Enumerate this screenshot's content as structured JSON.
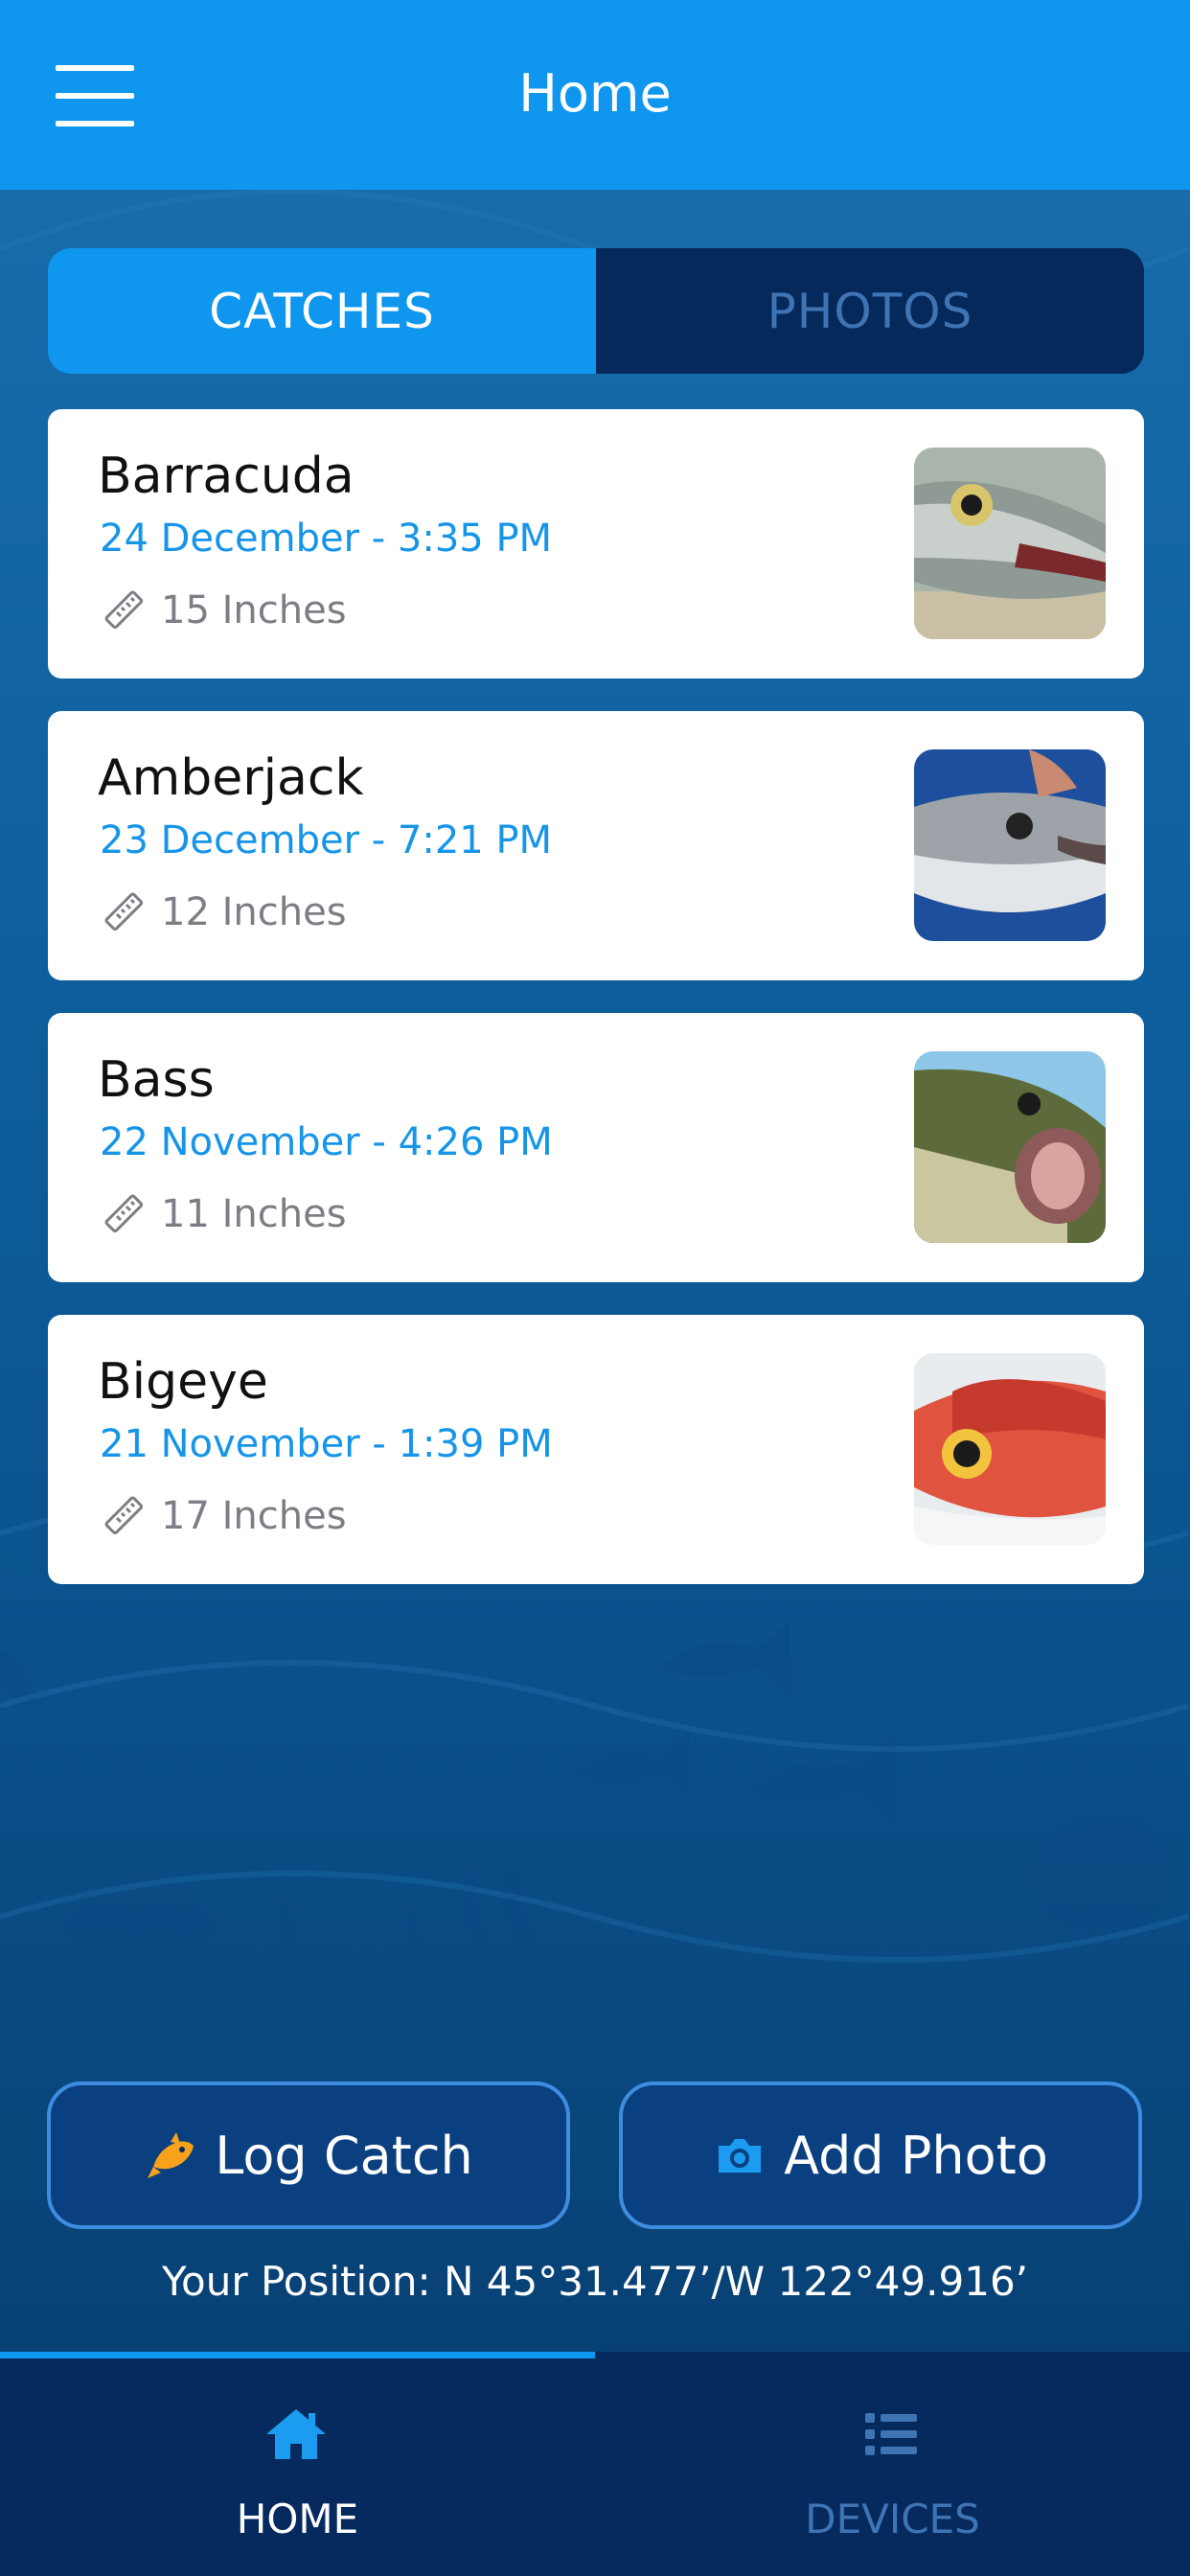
{
  "header": {
    "title": "Home",
    "menu_icon": "hamburger-menu-icon"
  },
  "tabs": [
    {
      "label": "CATCHES",
      "active": true
    },
    {
      "label": "PHOTOS",
      "active": false
    }
  ],
  "catches": [
    {
      "name": "Barracuda",
      "date": "24 December - 3:35 PM",
      "length": "15 Inches",
      "photo": "barracuda-photo"
    },
    {
      "name": "Amberjack",
      "date": "23 December - 7:21 PM",
      "length": "12 Inches",
      "photo": "amberjack-photo"
    },
    {
      "name": "Bass",
      "date": "22 November - 4:26 PM",
      "length": "11 Inches",
      "photo": "bass-photo"
    },
    {
      "name": "Bigeye",
      "date": "21 November - 1:39 PM",
      "length": "17 Inches",
      "photo": "bigeye-photo"
    }
  ],
  "actions": {
    "log_catch": {
      "label": "Log Catch",
      "icon": "fish-icon",
      "icon_color": "#f6a21c"
    },
    "add_photo": {
      "label": "Add Photo",
      "icon": "camera-icon",
      "icon_color": "#1b9cf0"
    }
  },
  "position": {
    "text": "Your Position: N 45°31.477’/W 122°49.916’"
  },
  "bottom_nav": [
    {
      "label": "HOME",
      "icon": "home-icon",
      "active": true
    },
    {
      "label": "DEVICES",
      "icon": "list-icon",
      "active": false
    }
  ],
  "colors": {
    "accent": "#0f96ee",
    "dark_navy": "#06295c",
    "date_blue": "#1695e8",
    "inactive_nav": "#3f74b4"
  }
}
